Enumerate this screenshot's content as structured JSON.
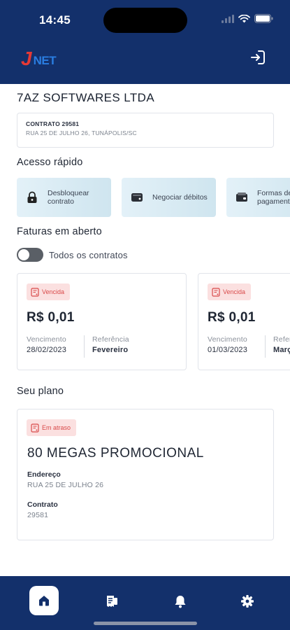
{
  "status_bar": {
    "time": "14:45"
  },
  "header": {
    "logo_j": "J",
    "logo_net": "NET",
    "logout_icon": "logout-icon"
  },
  "company": {
    "name": "7AZ SOFTWARES LTDA"
  },
  "contract": {
    "number": "CONTRATO 29581",
    "address": "RUA 25 DE JULHO 26, TUNÁPOLIS/SC"
  },
  "quick_access": {
    "title": "Acesso rápido",
    "items": [
      {
        "label": "Desbloquear contrato",
        "icon": "lock-icon"
      },
      {
        "label": "Negociar débitos",
        "icon": "wallet-icon"
      },
      {
        "label": "Formas de pagamento",
        "icon": "card-icon"
      }
    ]
  },
  "invoices": {
    "title": "Faturas em aberto",
    "toggle_label": "Todos os contratos",
    "toggle_on": false,
    "vencimento_label": "Vencimento",
    "referencia_label": "Referência",
    "items": [
      {
        "status": "Vencida",
        "amount": "R$ 0,01",
        "due": "28/02/2023",
        "reference": "Fevereiro"
      },
      {
        "status": "Vencida",
        "amount": "R$ 0,01",
        "due": "01/03/2023",
        "reference": "Março"
      }
    ]
  },
  "plan": {
    "title": "Seu plano",
    "status": "Em atraso",
    "name": "80 MEGAS PROMOCIONAL",
    "address_label": "Endereço",
    "address": "RUA 25 DE JULHO 26",
    "contract_label": "Contrato",
    "contract": "29581"
  },
  "nav": {
    "items": [
      "home-icon",
      "invoices-icon",
      "bell-icon",
      "gear-icon"
    ]
  },
  "colors": {
    "primary": "#13306b",
    "danger": "#d94a4a",
    "danger_bg": "#fbe0e0",
    "quick_bg": "#d9ebf4"
  }
}
